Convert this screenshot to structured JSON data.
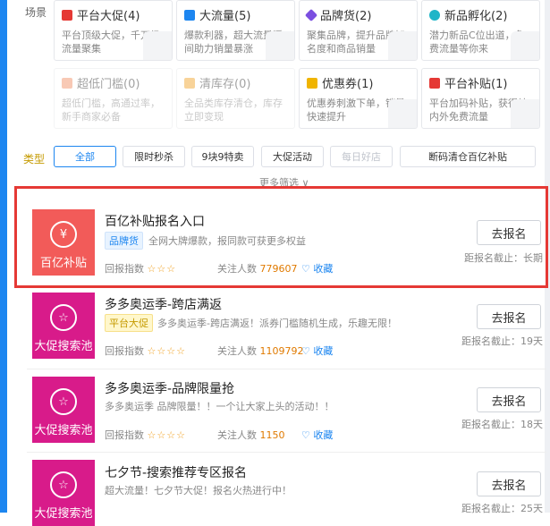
{
  "colors": {
    "accent": "#1d86f0",
    "red_thumb": "#f25b59",
    "magenta_thumb": "#d81b8a",
    "highlight_border": "#e53935",
    "star": "#f0a020",
    "count": "#e07a00"
  },
  "scene": {
    "label": "场景",
    "cards": [
      {
        "title": "平台大促(4)",
        "desc": "平台顶级大促，千万级流量聚集",
        "icon": "flag-icon",
        "icon_color": "#e53935",
        "dim": false
      },
      {
        "title": "大流量(5)",
        "desc": "爆款利器，超大流量瞬间助力销量暴涨",
        "icon": "grid-icon",
        "icon_color": "#1d86f0",
        "dim": false
      },
      {
        "title": "品牌货(2)",
        "desc": "聚集品牌，提升品牌知名度和商品销量",
        "icon": "diamond-icon",
        "icon_color": "#7b4fe0",
        "dim": false
      },
      {
        "title": "新品孵化(2)",
        "desc": "潜力新品C位出道，免费流量等你来",
        "icon": "leaf-icon",
        "icon_color": "#1fb5c8",
        "dim": false
      },
      {
        "title": "超低门槛(0)",
        "desc": "超低门槛，高通过率，新手商家必备",
        "icon": "phone-icon",
        "icon_color": "#f08a5d",
        "dim": true
      },
      {
        "title": "清库存(0)",
        "desc": "全品类库存清仓，库存立即变现",
        "icon": "box-icon",
        "icon_color": "#f0a020",
        "dim": true
      },
      {
        "title": "优惠券(1)",
        "desc": "优惠券刺激下单，销量快速提升",
        "icon": "coupon-icon",
        "icon_color": "#f0b400",
        "dim": false
      },
      {
        "title": "平台补贴(1)",
        "desc": "平台加码补贴，获得站内外免费流量",
        "icon": "money-icon",
        "icon_color": "#e53935",
        "dim": false
      }
    ]
  },
  "type_filter": {
    "label": "类型",
    "buttons": [
      {
        "label": "全部",
        "state": "active"
      },
      {
        "label": "限时秒杀",
        "state": "normal"
      },
      {
        "label": "9块9特卖",
        "state": "normal"
      },
      {
        "label": "大促活动",
        "state": "normal"
      },
      {
        "label": "每日好店",
        "state": "disabled"
      },
      {
        "label": "断码清仓百亿补贴",
        "state": "normal"
      }
    ],
    "more": "更多筛选 ∨"
  },
  "activities": [
    {
      "thumb_text": "百亿补贴",
      "thumb_color": "#f25b59",
      "thumb_icon": "¥",
      "title": "百亿补贴报名入口",
      "tag": "品牌货",
      "tag_style": "blue",
      "desc": "全网大牌爆款，报同款可获更多权益",
      "rating_label": "回报指数",
      "stars": "☆☆☆",
      "follow_label": "关注人数",
      "follow_count": "779607",
      "fav_label": "♡ 收藏",
      "button": "去报名",
      "deadline": "距报名截止：长期"
    },
    {
      "thumb_text": "大促搜索池",
      "thumb_color": "#d81b8a",
      "thumb_icon": "☆",
      "title": "多多奥运季-跨店满返",
      "tag": "平台大促",
      "tag_style": "yellow",
      "desc": "多多奥运季-跨店满返！派券门槛随机生成，乐趣无限！",
      "rating_label": "回报指数",
      "stars": "☆☆☆☆",
      "follow_label": "关注人数",
      "follow_count": "1109792",
      "fav_label": "♡ 收藏",
      "button": "去报名",
      "deadline": "距报名截止：19天"
    },
    {
      "thumb_text": "大促搜索池",
      "thumb_color": "#d81b8a",
      "thumb_icon": "☆",
      "title": "多多奥运季-品牌限量抢",
      "tag": "",
      "tag_style": "",
      "desc": "多多奥运季 品牌限量！！一个让大家上头的活动！！",
      "rating_label": "回报指数",
      "stars": "☆☆☆☆",
      "follow_label": "关注人数",
      "follow_count": "1150",
      "fav_label": "♡ 收藏",
      "button": "去报名",
      "deadline": "距报名截止：18天"
    },
    {
      "thumb_text": "大促搜索池",
      "thumb_color": "#d81b8a",
      "thumb_icon": "☆",
      "title": "七夕节-搜索推荐专区报名",
      "tag": "",
      "tag_style": "",
      "desc": "超大流量！七夕节大促！报名火热进行中！",
      "rating_label": "",
      "stars": "",
      "follow_label": "",
      "follow_count": "",
      "fav_label": "",
      "button": "去报名",
      "deadline": "距报名截止：25天"
    }
  ]
}
